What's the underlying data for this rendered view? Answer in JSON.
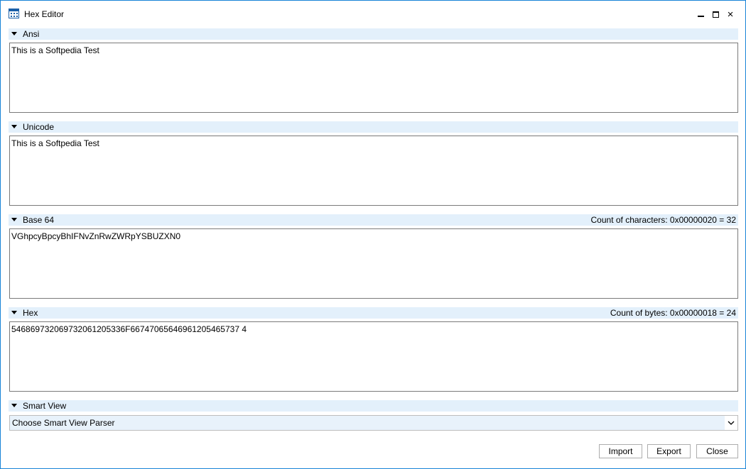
{
  "window": {
    "title": "Hex Editor",
    "icon": "grid-window-icon",
    "controls": {
      "minimize": "minimize-icon",
      "maximize": "maximize-icon",
      "close": "×"
    }
  },
  "sections": {
    "ansi": {
      "label": "Ansi",
      "value": "This is a Softpedia Test"
    },
    "unicode": {
      "label": "Unicode",
      "value": "This is a Softpedia Test"
    },
    "base64": {
      "label": "Base 64",
      "count": "Count of characters: 0x00000020 = 32",
      "value": "VGhpcyBpcyBhIFNvZnRwZWRpYSBUZXN0"
    },
    "hex": {
      "label": "Hex",
      "count": "Count of bytes: 0x00000018 = 24",
      "value": "546869732069732061205336F66747065646961205465737 4"
    },
    "smart_view": {
      "label": "Smart View",
      "selected": "Choose Smart View Parser"
    }
  },
  "buttons": {
    "import": "Import",
    "export": "Export",
    "close": "Close"
  },
  "colors": {
    "accent": "#1883d7",
    "header_bg": "#e3f0fb",
    "combo_bg": "#e8f2fb"
  }
}
